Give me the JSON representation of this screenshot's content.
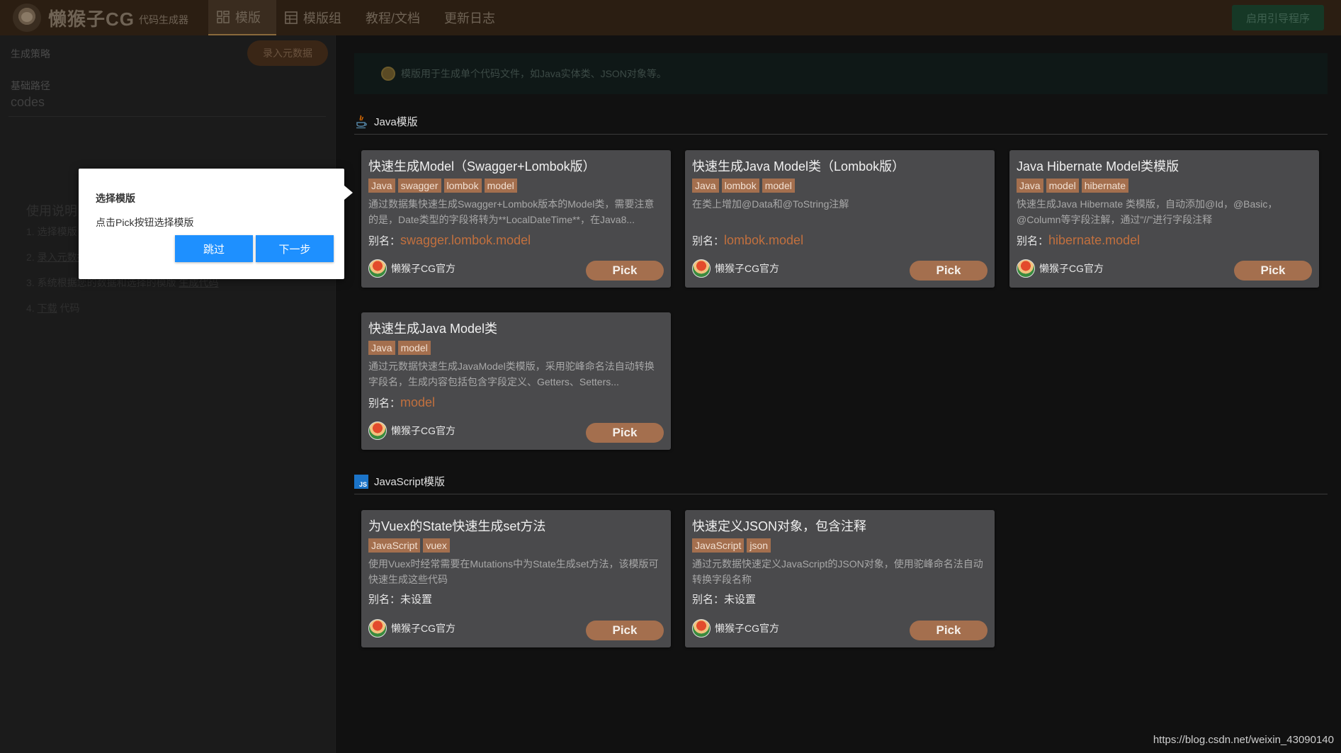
{
  "app": {
    "title": "懒猴子CG",
    "subtitle": "代码生成器"
  },
  "nav": [
    {
      "label": "模版",
      "icon": "grid-icon",
      "active": true
    },
    {
      "label": "模版组",
      "icon": "table-icon",
      "active": false
    },
    {
      "label": "教程/文档",
      "icon": "",
      "active": false
    },
    {
      "label": "更新日志",
      "icon": "",
      "active": false
    }
  ],
  "header": {
    "guide_label": "启用引导程序"
  },
  "sidebar": {
    "strategy_label": "生成策略",
    "record_label": "录入元数据",
    "base_path_label": "基础路径",
    "base_path_value": "codes",
    "usage_title": "使用说明",
    "steps": [
      {
        "num": "1.",
        "text": "选择模版"
      },
      {
        "num": "2.",
        "link": "录入元数据",
        "text": ""
      },
      {
        "num": "3.",
        "text": "系统根据您的数据和选择的模版",
        "link": "生成代码"
      },
      {
        "num": "4.",
        "link": "下载",
        "text": "代码"
      }
    ]
  },
  "notice": {
    "text": "模版用于生成单个代码文件，如Java实体类、JSON对象等。"
  },
  "sections": [
    {
      "title": "Java模版",
      "icon": "java-icon",
      "cards": [
        {
          "title": "快速生成Model（Swagger+Lombok版）",
          "tags": [
            "Java",
            "swagger",
            "lombok",
            "model"
          ],
          "desc": "通过数据集快速生成Swagger+Lombok版本的Model类，需要注意的是，Date类型的字段将转为**LocalDateTime**，在Java8...",
          "alias_label": "别名：",
          "alias": "swagger.lombok.model",
          "alias_set": true,
          "author": "懒猴子CG官方",
          "pick": "Pick"
        },
        {
          "title": "快速生成Java Model类（Lombok版）",
          "tags": [
            "Java",
            "lombok",
            "model"
          ],
          "desc": "在类上增加@Data和@ToString注解",
          "alias_label": "别名：",
          "alias": "lombok.model",
          "alias_set": true,
          "author": "懒猴子CG官方",
          "pick": "Pick"
        },
        {
          "title": "Java Hibernate Model类模版",
          "tags": [
            "Java",
            "model",
            "hibernate"
          ],
          "desc": "快速生成Java Hibernate 类模版，自动添加@Id，@Basic，@Column等字段注解，通过\"//\"进行字段注释",
          "alias_label": "别名：",
          "alias": "hibernate.model",
          "alias_set": true,
          "author": "懒猴子CG官方",
          "pick": "Pick"
        },
        {
          "title": "快速生成Java Model类",
          "tags": [
            "Java",
            "model"
          ],
          "desc": "通过元数据快速生成JavaModel类模版，采用驼峰命名法自动转换字段名，生成内容包括包含字段定义、Getters、Setters...",
          "alias_label": "别名：",
          "alias": "model",
          "alias_set": true,
          "author": "懒猴子CG官方",
          "pick": "Pick"
        }
      ]
    },
    {
      "title": "JavaScript模版",
      "icon": "javascript-icon",
      "cards": [
        {
          "title": "为Vuex的State快速生成set方法",
          "tags": [
            "JavaScript",
            "vuex"
          ],
          "desc": "使用Vuex时经常需要在Mutations中为State生成set方法，该模版可快速生成这些代码",
          "alias_label": "别名：",
          "alias": "未设置",
          "alias_set": false,
          "author": "懒猴子CG官方",
          "pick": "Pick"
        },
        {
          "title": "快速定义JSON对象，包含注释",
          "tags": [
            "JavaScript",
            "json"
          ],
          "desc": "通过元数据快速定义JavaScript的JSON对象，使用驼峰命名法自动转换字段名称",
          "alias_label": "别名：",
          "alias": "未设置",
          "alias_set": false,
          "author": "懒猴子CG官方",
          "pick": "Pick"
        }
      ]
    }
  ],
  "popover": {
    "title": "选择模版",
    "body": "点击Pick按钮选择模版",
    "skip_label": "跳过",
    "next_label": "下一步"
  },
  "watermark": "https://blog.csdn.net/weixin_43090140"
}
